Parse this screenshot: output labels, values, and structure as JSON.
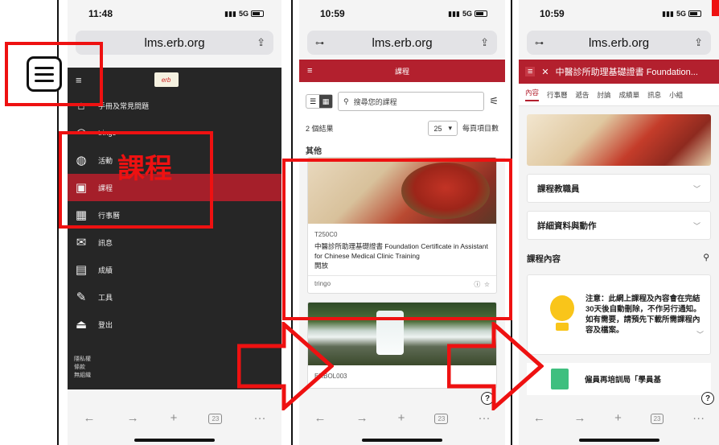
{
  "phone1": {
    "status": {
      "time": "11:48",
      "signal": "5G"
    },
    "url": "lms.erb.org",
    "logo_text": "erb",
    "menu": [
      {
        "icon": "home-icon",
        "glyph": "⌂",
        "label": "手冊及常見問題"
      },
      {
        "icon": "user-icon",
        "glyph": "◠",
        "label": "tringo"
      },
      {
        "icon": "globe-icon",
        "glyph": "◍",
        "label": "活動"
      },
      {
        "icon": "course-icon",
        "glyph": "▣",
        "label": "課程"
      },
      {
        "icon": "calendar-icon",
        "glyph": "▦",
        "label": "行事曆"
      },
      {
        "icon": "mail-icon",
        "glyph": "✉",
        "label": "訊息"
      },
      {
        "icon": "grades-icon",
        "glyph": "▤",
        "label": "成績"
      },
      {
        "icon": "tools-icon",
        "glyph": "✎",
        "label": "工具"
      },
      {
        "icon": "logout-icon",
        "glyph": "⏏",
        "label": "登出"
      }
    ],
    "footer": [
      "隱私權",
      "條款",
      "無組織"
    ],
    "annotation": "課程",
    "tabs_count": "23"
  },
  "phone2": {
    "status": {
      "time": "10:59",
      "signal": "5G"
    },
    "url": "lms.erb.org",
    "header_title": "課程",
    "search_placeholder": "搜尋您的課程",
    "results_count": "2 個結果",
    "per_page_value": "25",
    "per_page_label": "每頁項目數",
    "category": "其他",
    "course1": {
      "code": "T250C0",
      "title": "中醫診所助理基礎證書 Foundation Certificate in Assistant for Chinese Medical Clinic Training",
      "status": "開放",
      "provider": "tringo"
    },
    "course2": {
      "code": "ERBOL003"
    },
    "tabs_count": "23"
  },
  "phone3": {
    "status": {
      "time": "10:59",
      "signal": "5G"
    },
    "url": "lms.erb.org",
    "course_title": "中醫診所助理基礎證書 Foundation...",
    "tabs": [
      "內容",
      "行事曆",
      "遞告",
      "討論",
      "成績單",
      "訊息",
      "小組"
    ],
    "sections": {
      "instructors": "課程教職員",
      "details": "詳細資料與動作",
      "content": "課程內容"
    },
    "notice": "注意：此網上課程及內容會在完結30天後自動刪除，不作另行通知。如有需要，請預先下載所需課程內容及檔案。",
    "next_item": "僱員再培訓局「學員基",
    "tabs_count": "23"
  },
  "colors": {
    "brand_red": "#b3202e",
    "annotation_red": "#ee1111"
  }
}
